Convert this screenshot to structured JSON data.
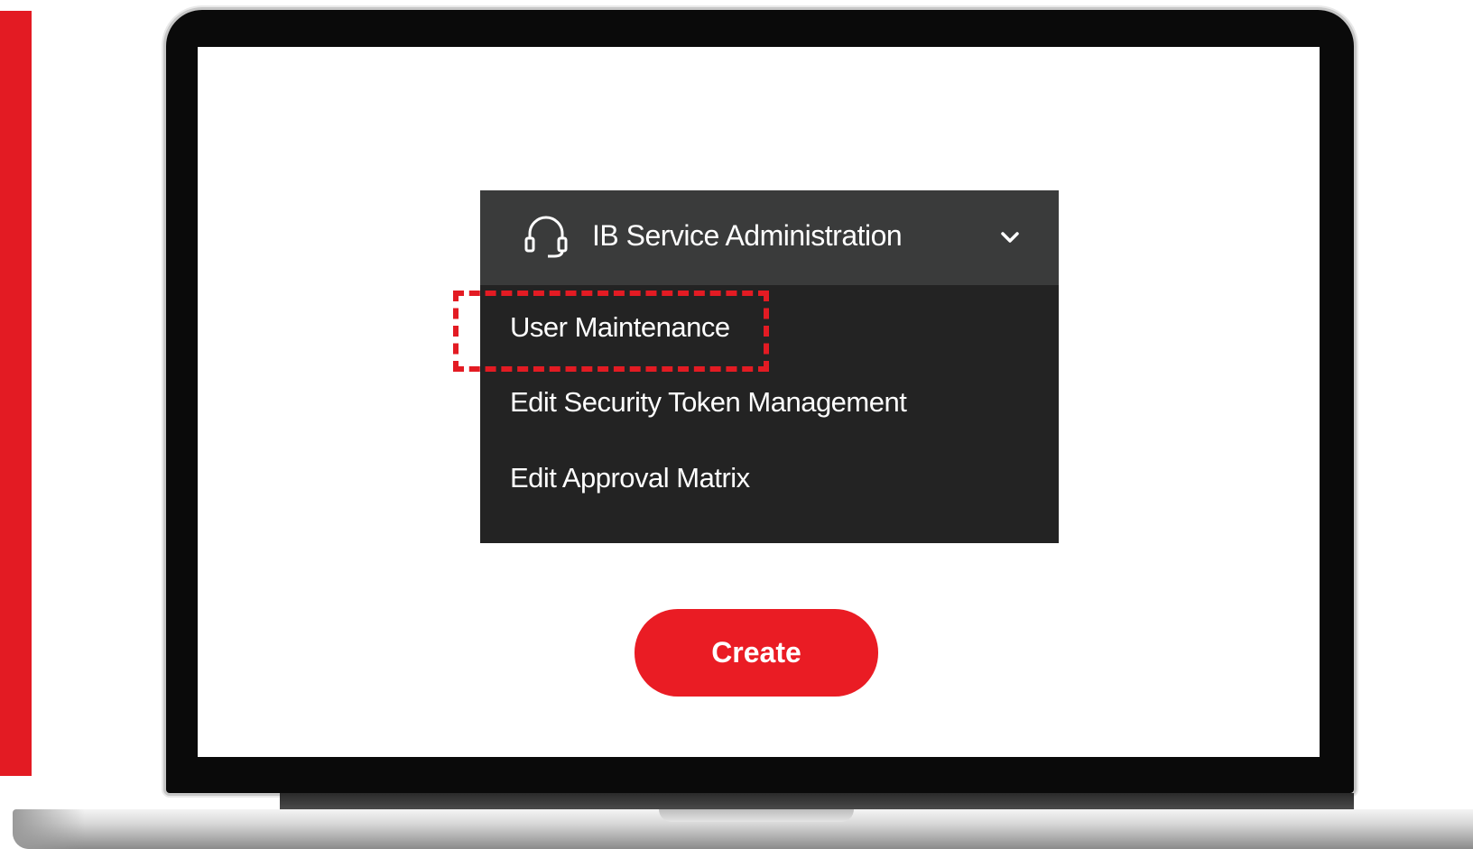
{
  "menu": {
    "header": {
      "icon": "headset-icon",
      "title": "IB Service Administration",
      "toggle_icon": "chevron-down-icon"
    },
    "items": [
      {
        "label": "User Maintenance",
        "highlighted": true
      },
      {
        "label": "Edit Security Token Management",
        "highlighted": false
      },
      {
        "label": "Edit Approval Matrix",
        "highlighted": false
      }
    ]
  },
  "actions": {
    "create_label": "Create"
  },
  "colors": {
    "accent_red": "#e31b23",
    "menu_header_bg": "#3a3b3b",
    "menu_body_bg": "#232323",
    "text_on_dark": "#ffffff"
  }
}
